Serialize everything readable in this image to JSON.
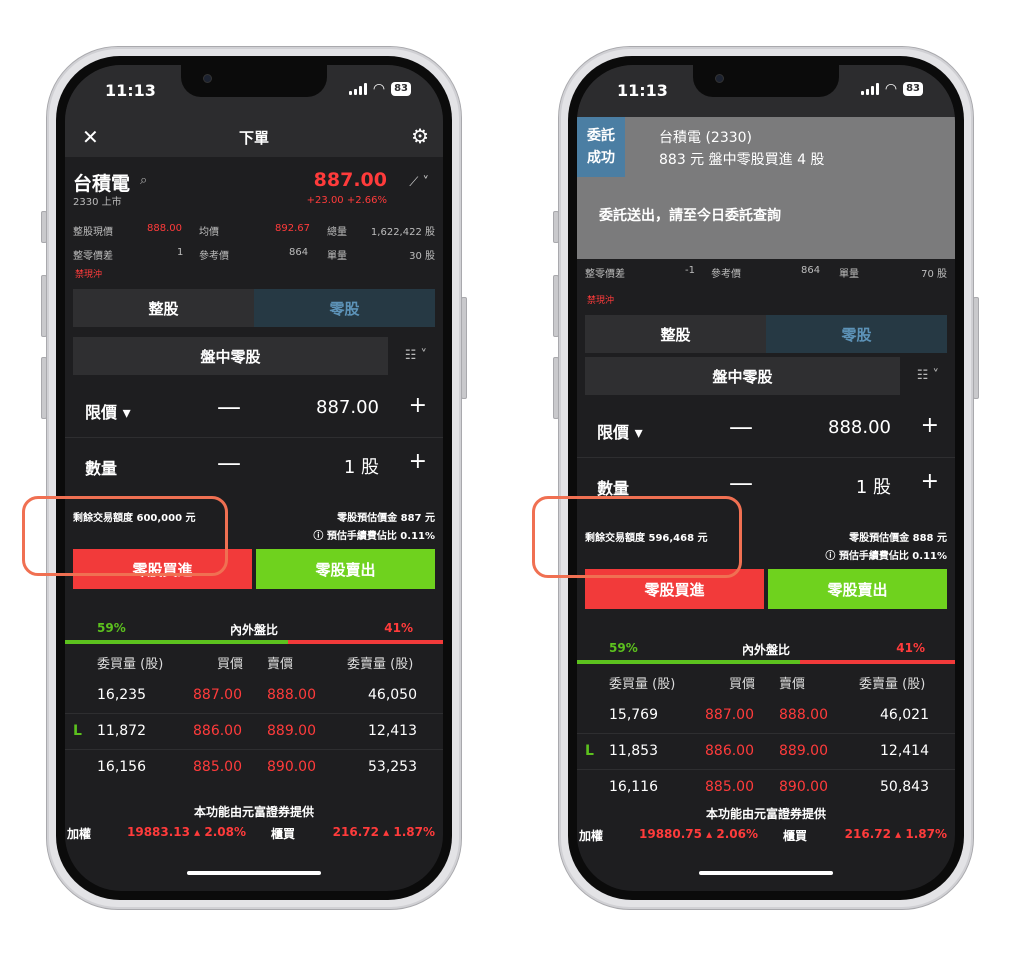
{
  "phone_left": {
    "status": {
      "time": "11:13",
      "battery": "83"
    },
    "navbar": {
      "title": "下單"
    },
    "stock": {
      "name": "台積電",
      "code_market": "2330 上市",
      "price": "887.00",
      "change": "+23.00  +2.66%"
    },
    "info_row1": {
      "l1": "整股現價",
      "v1": "888.00",
      "l2": "均價",
      "v2": "892.67",
      "l3": "總量",
      "v3": "1,622,422 股"
    },
    "info_row2": {
      "l1": "整零價差",
      "v1": "1",
      "l2": "參考價",
      "v2": "864",
      "l3": "單量",
      "v3": "30 股"
    },
    "tag": "禁現沖",
    "segment": {
      "whole": "整股",
      "odd": "零股"
    },
    "market_type": "盤中零股",
    "price_row": {
      "label": "限價 ▾",
      "minus": "—",
      "value": "887.00",
      "plus": "+"
    },
    "qty_row": {
      "label": "數量",
      "minus": "—",
      "value": "1 股",
      "plus": "+"
    },
    "remaining": "剩餘交易額度 600,000 元",
    "est_price": "零股預估價金 887 元",
    "est_fee": "ⓘ 預估手續費佔比 0.11%",
    "buy": "零股買進",
    "sell": "零股賣出",
    "ratio": {
      "left": "59%",
      "label": "內外盤比",
      "right": "41%",
      "left_fraction": 0.59
    },
    "book_header": [
      "委買量 (股)",
      "買價",
      "賣價",
      "委賣量 (股)"
    ],
    "book": [
      {
        "mark": "",
        "bidqty": "16,235",
        "bid": "887.00",
        "ask": "888.00",
        "askqty": "46,050"
      },
      {
        "mark": "L",
        "bidqty": "11,872",
        "bid": "886.00",
        "ask": "889.00",
        "askqty": "12,413"
      },
      {
        "mark": "",
        "bidqty": "16,156",
        "bid": "885.00",
        "ask": "890.00",
        "askqty": "53,253"
      }
    ],
    "credit": "本功能由元富證券提供",
    "ticker": {
      "l1": "加權",
      "v1": "19883.13 ▴ 2.08%",
      "l2": "櫃買",
      "v2": "216.72 ▴ 1.87%"
    }
  },
  "phone_right": {
    "status": {
      "time": "11:13",
      "battery": "83"
    },
    "toast": {
      "badge_l1": "委託",
      "badge_l2": "成功",
      "line1": "台積電 (2330)",
      "line2": "883 元 盤中零股買進 4 股",
      "line3": "委託送出，請至今日委託查詢"
    },
    "info_row2": {
      "l1": "整零價差",
      "v1": "-1",
      "l2": "參考價",
      "v2": "864",
      "l3": "單量",
      "v3": "70 股"
    },
    "tag": "禁現沖",
    "segment": {
      "whole": "整股",
      "odd": "零股"
    },
    "market_type": "盤中零股",
    "price_row": {
      "label": "限價 ▾",
      "minus": "—",
      "value": "888.00",
      "plus": "+"
    },
    "qty_row": {
      "label": "數量",
      "minus": "—",
      "value": "1 股",
      "plus": "+"
    },
    "remaining": "剩餘交易額度 596,468 元",
    "est_price": "零股預估價金 888 元",
    "est_fee": "ⓘ 預估手續費佔比 0.11%",
    "buy": "零股買進",
    "sell": "零股賣出",
    "ratio": {
      "left": "59%",
      "label": "內外盤比",
      "right": "41%",
      "left_fraction": 0.59
    },
    "book_header": [
      "委買量 (股)",
      "買價",
      "賣價",
      "委賣量 (股)"
    ],
    "book": [
      {
        "mark": "",
        "bidqty": "15,769",
        "bid": "887.00",
        "ask": "888.00",
        "askqty": "46,021"
      },
      {
        "mark": "L",
        "bidqty": "11,853",
        "bid": "886.00",
        "ask": "889.00",
        "askqty": "12,414"
      },
      {
        "mark": "",
        "bidqty": "16,116",
        "bid": "885.00",
        "ask": "890.00",
        "askqty": "50,843"
      }
    ],
    "credit": "本功能由元富證券提供",
    "ticker": {
      "l1": "加權",
      "v1": "19880.75 ▴ 2.06%",
      "l2": "櫃買",
      "v2": "216.72 ▴ 1.87%"
    }
  },
  "colors": {
    "up": "#ff3b3b",
    "down_green": "#6fd21e",
    "highlight": "#f07052",
    "odd_lot_tab": "#263944",
    "toast_badge": "#4b7ea3"
  }
}
